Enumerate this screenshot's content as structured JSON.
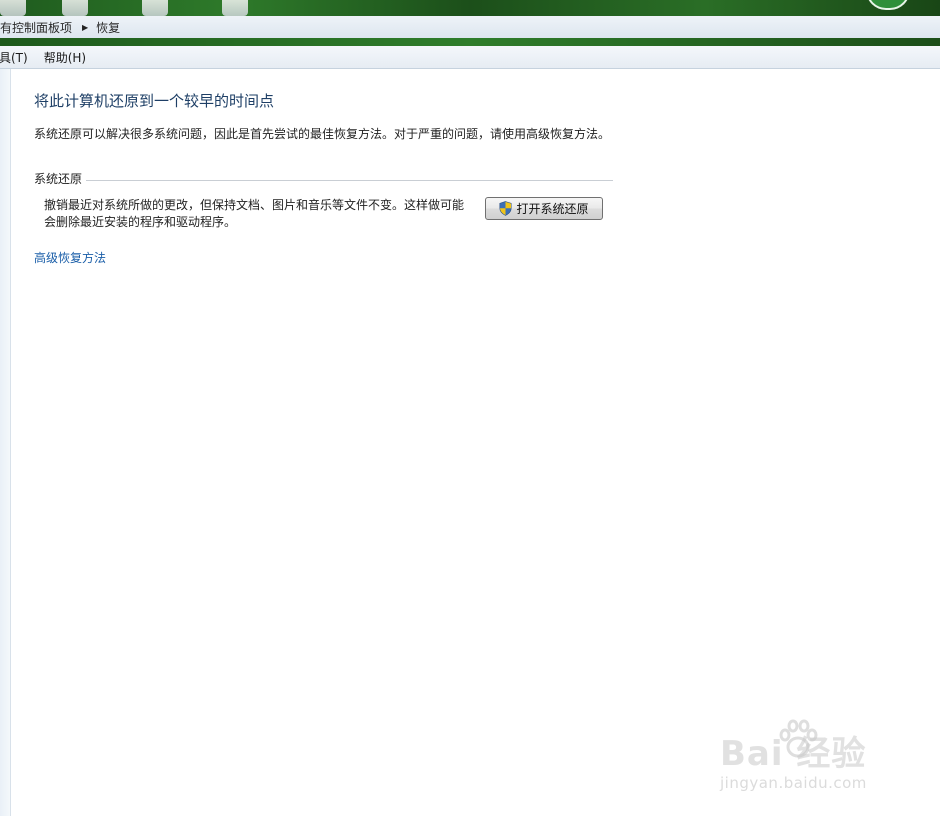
{
  "breadcrumb": {
    "items": [
      "所有控制面板项",
      "恢复"
    ]
  },
  "menu": {
    "items": [
      "工具(T)",
      "帮助(H)"
    ]
  },
  "page": {
    "title": "将此计算机还原到一个较早的时间点",
    "description": "系统还原可以解决很多系统问题，因此是首先尝试的最佳恢复方法。对于严重的问题，请使用高级恢复方法。"
  },
  "system_restore": {
    "section_label": "系统还原",
    "text": "撤销最近对系统所做的更改，但保持文档、图片和音乐等文件不变。这样做可能会删除最近安装的程序和驱动程序。",
    "button_label": "打开系统还原",
    "button_icon": "uac-shield-icon"
  },
  "advanced_link": "高级恢复方法",
  "watermark": {
    "brand": "Bai  经验",
    "url": "jingyan.baidu.com"
  },
  "colors": {
    "title": "#1e3f66",
    "link": "#1a5ea8",
    "wallpaper": "#2e7a2a"
  }
}
